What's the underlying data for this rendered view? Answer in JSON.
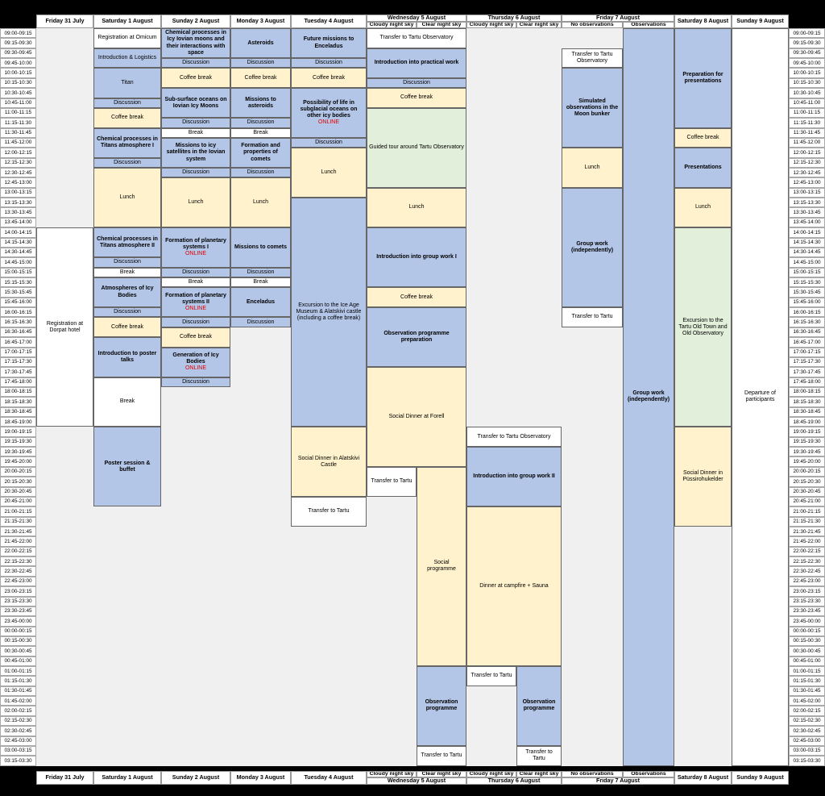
{
  "colors": {
    "session": "#b4c6e7",
    "break": "#fff2cc",
    "tour": "#e2efda",
    "free": "#ffffff",
    "empty": "#f0f0f0",
    "online": "#e00000"
  },
  "days_top": [
    "Friday 31 July",
    "Saturday 1 August",
    "Sunday 2 August",
    "Monday 3 August",
    "Tuesday 4 August",
    "Wednesday 5 August",
    "Thursday 6 August",
    "Friday 7 August",
    "Saturday 8 August",
    "Sunday 9 August"
  ],
  "days_bottom": [
    "Friday 31 July",
    "Saturday 1 August",
    "Sunday 2 August",
    "Monday 3 August",
    "Tuesday 4 August",
    "Wednesday 5 August",
    "Thursday 6 August",
    "Friday 7 August",
    "Saturday 8 August",
    "Sunday 9 August"
  ],
  "sub_top": {
    "wed_cloudy": "Cloudy night sky",
    "wed_clear": "Clear night sky",
    "thu_cloudy": "Cloudy night sky",
    "thu_clear": "Clear night sky",
    "fri_no": "No observations",
    "fri_obs": "Observations"
  },
  "sub_bottom": {
    "wed_cloudy": "Cloudy night sky",
    "wed_clear": "Clear night sky",
    "thu_cloudy": "Cloudy night sky",
    "thu_clear": "Clear night sky",
    "fri_no": "No observations",
    "fri_obs": "Observations"
  },
  "times": [
    "09:00-09:15",
    "09:15-09:30",
    "09:30-09:45",
    "09:45-10:00",
    "10:00-10:15",
    "10:15-10:30",
    "10:30-10:45",
    "10:45-11:00",
    "11:00-11:15",
    "11:15-11:30",
    "11:30-11:45",
    "11:45-12:00",
    "12:00-12:15",
    "12:15-12:30",
    "12:30-12:45",
    "12:45-13:00",
    "13:00-13:15",
    "13:15-13:30",
    "13:30-13:45",
    "13:45-14:00",
    "14:00-14:15",
    "14:15-14:30",
    "14:30-14:45",
    "14:45-15:00",
    "15:00-15:15",
    "15:15-15:30",
    "15:30-15:45",
    "15:45-16:00",
    "16:00-16:15",
    "16:15-16:30",
    "16:30-16:45",
    "16:45-17:00",
    "17:00-17:15",
    "17:15-17:30",
    "17:30-17:45",
    "17:45-18:00",
    "18:00-18:15",
    "18:15-18:30",
    "18:30-18:45",
    "18:45-19:00",
    "19:00-19:15",
    "19:15-19:30",
    "19:30-19:45",
    "19:45-20:00",
    "20:00-20:15",
    "20:15-20:30",
    "20:30-20:45",
    "20:45-21:00",
    "21:00-21:15",
    "21:15-21:30",
    "21:30-21:45",
    "21:45-22:00",
    "22:00-22:15",
    "22:15-22:30",
    "22:30-22:45",
    "22:45-23:00",
    "23:00-23:15",
    "23:15-23:30",
    "23:30-23:45",
    "23:45-00:00",
    "00:00-00:15",
    "00:15-00:30",
    "00:30-00:45",
    "00:45-01:00",
    "01:00-01:15",
    "01:15-01:30",
    "01:30-01:45",
    "01:45-02:00",
    "02:00-02:15",
    "02:15-02:30",
    "02:30-02:45",
    "02:45-03:00",
    "03:00-03:15",
    "03:15-03:30"
  ],
  "events": [
    {
      "col": "fri",
      "start": 0,
      "span": 20,
      "text": "",
      "style": "gry"
    },
    {
      "col": "fri",
      "start": 20,
      "span": 20,
      "text": "Registration at Dorpat hotel",
      "style": "wht"
    },
    {
      "col": "fri",
      "start": 40,
      "span": 34,
      "text": "",
      "style": "gry"
    },
    {
      "col": "sat1",
      "start": 0,
      "span": 2,
      "text": "Registration at Omicum",
      "style": "wht"
    },
    {
      "col": "sat1",
      "start": 2,
      "span": 2,
      "text": "Introduction & Logistics",
      "style": "blue"
    },
    {
      "col": "sat1",
      "start": 4,
      "span": 3,
      "text": "Titan",
      "style": "blue"
    },
    {
      "col": "sat1",
      "start": 7,
      "span": 1,
      "text": "Discussion",
      "style": "blue"
    },
    {
      "col": "sat1",
      "start": 8,
      "span": 2,
      "text": "Coffee break",
      "style": "yel"
    },
    {
      "col": "sat1",
      "start": 10,
      "span": 3,
      "text": "Chemical processes in Titans atmosphere I",
      "style": "blue",
      "bold": true
    },
    {
      "col": "sat1",
      "start": 13,
      "span": 1,
      "text": "Discussion",
      "style": "blue"
    },
    {
      "col": "sat1",
      "start": 14,
      "span": 6,
      "text": "Lunch",
      "style": "yel"
    },
    {
      "col": "sat1",
      "start": 20,
      "span": 3,
      "text": "Chemical processes in Titans atmosphere II",
      "style": "blue",
      "bold": true
    },
    {
      "col": "sat1",
      "start": 23,
      "span": 1,
      "text": "Discussion",
      "style": "blue"
    },
    {
      "col": "sat1",
      "start": 24,
      "span": 1,
      "text": "Break",
      "style": "wht"
    },
    {
      "col": "sat1",
      "start": 25,
      "span": 3,
      "text": "Atmospheres of Icy Bodies",
      "style": "blue",
      "bold": true
    },
    {
      "col": "sat1",
      "start": 28,
      "span": 1,
      "text": "Discussion",
      "style": "blue"
    },
    {
      "col": "sat1",
      "start": 29,
      "span": 2,
      "text": "Coffee break",
      "style": "yel"
    },
    {
      "col": "sat1",
      "start": 31,
      "span": 4,
      "text": "Introduction to poster talks",
      "style": "blue",
      "bold": true
    },
    {
      "col": "sat1",
      "start": 35,
      "span": 5,
      "text": "Break",
      "style": "wht"
    },
    {
      "col": "sat1",
      "start": 40,
      "span": 8,
      "text": "Poster session & buffet",
      "style": "blue",
      "bold": true
    },
    {
      "col": "sat1",
      "start": 48,
      "span": 26,
      "text": "",
      "style": "gry"
    },
    {
      "col": "sun2",
      "start": 0,
      "span": 3,
      "text": "Chemical processes in Icy Iovian moons and their interactions with space",
      "style": "blue",
      "bold": true
    },
    {
      "col": "sun2",
      "start": 3,
      "span": 1,
      "text": "Discussion",
      "style": "blue"
    },
    {
      "col": "sun2",
      "start": 4,
      "span": 2,
      "text": "Coffee break",
      "style": "yel"
    },
    {
      "col": "sun2",
      "start": 6,
      "span": 3,
      "text": "Sub-surface oceans on Iovian Icy Moons",
      "style": "blue",
      "bold": true
    },
    {
      "col": "sun2",
      "start": 9,
      "span": 1,
      "text": "Discussion",
      "style": "blue"
    },
    {
      "col": "sun2",
      "start": 10,
      "span": 1,
      "text": "Break",
      "style": "wht"
    },
    {
      "col": "sun2",
      "start": 11,
      "span": 3,
      "text": "Missions to icy satellites in the Iovian system",
      "style": "blue",
      "bold": true
    },
    {
      "col": "sun2",
      "start": 14,
      "span": 1,
      "text": "Discussion",
      "style": "blue"
    },
    {
      "col": "sun2",
      "start": 15,
      "span": 5,
      "text": "Lunch",
      "style": "yel"
    },
    {
      "col": "sun2",
      "start": 20,
      "span": 4,
      "text": "Formation of planetary systems I",
      "style": "blue",
      "bold": true,
      "online": "ONLINE"
    },
    {
      "col": "sun2",
      "start": 24,
      "span": 1,
      "text": "Discussion",
      "style": "blue"
    },
    {
      "col": "sun2",
      "start": 25,
      "span": 1,
      "text": "Break",
      "style": "wht"
    },
    {
      "col": "sun2",
      "start": 26,
      "span": 3,
      "text": "Formation of planetary systems II",
      "style": "blue",
      "bold": true,
      "online": "ONLINE"
    },
    {
      "col": "sun2",
      "start": 29,
      "span": 1,
      "text": "Discussion",
      "style": "blue"
    },
    {
      "col": "sun2",
      "start": 30,
      "span": 2,
      "text": "Coffee break",
      "style": "yel"
    },
    {
      "col": "sun2",
      "start": 32,
      "span": 3,
      "text": "Generation of Icy Bodies",
      "style": "blue",
      "bold": true,
      "online": "ONLINE"
    },
    {
      "col": "sun2",
      "start": 35,
      "span": 1,
      "text": "Discussion",
      "style": "blue"
    },
    {
      "col": "sun2",
      "start": 36,
      "span": 38,
      "text": "",
      "style": "gry"
    },
    {
      "col": "mon3",
      "start": 0,
      "span": 3,
      "text": "Asteroids",
      "style": "blue",
      "bold": true
    },
    {
      "col": "mon3",
      "start": 3,
      "span": 1,
      "text": "Discussion",
      "style": "blue"
    },
    {
      "col": "mon3",
      "start": 4,
      "span": 2,
      "text": "Coffee break",
      "style": "yel"
    },
    {
      "col": "mon3",
      "start": 6,
      "span": 3,
      "text": "Missions to asteroids",
      "style": "blue",
      "bold": true
    },
    {
      "col": "mon3",
      "start": 9,
      "span": 1,
      "text": "Discussion",
      "style": "blue"
    },
    {
      "col": "mon3",
      "start": 10,
      "span": 1,
      "text": "Break",
      "style": "wht"
    },
    {
      "col": "mon3",
      "start": 11,
      "span": 3,
      "text": "Formation and properties of comets",
      "style": "blue",
      "bold": true
    },
    {
      "col": "mon3",
      "start": 14,
      "span": 1,
      "text": "Discussion",
      "style": "blue"
    },
    {
      "col": "mon3",
      "start": 15,
      "span": 5,
      "text": "Lunch",
      "style": "yel"
    },
    {
      "col": "mon3",
      "start": 20,
      "span": 4,
      "text": "Missions to comets",
      "style": "blue",
      "bold": true
    },
    {
      "col": "mon3",
      "start": 24,
      "span": 1,
      "text": "Discussion",
      "style": "blue"
    },
    {
      "col": "mon3",
      "start": 25,
      "span": 1,
      "text": "Break",
      "style": "wht"
    },
    {
      "col": "mon3",
      "start": 26,
      "span": 3,
      "text": "Enceladus",
      "style": "blue",
      "bold": true
    },
    {
      "col": "mon3",
      "start": 29,
      "span": 1,
      "text": "Discussion",
      "style": "blue"
    },
    {
      "col": "mon3",
      "start": 30,
      "span": 44,
      "text": "",
      "style": "gry"
    },
    {
      "col": "tue4",
      "start": 0,
      "span": 3,
      "text": "Future missions to Enceladus",
      "style": "blue",
      "bold": true
    },
    {
      "col": "tue4",
      "start": 3,
      "span": 1,
      "text": "Discussion",
      "style": "blue"
    },
    {
      "col": "tue4",
      "start": 4,
      "span": 2,
      "text": "Coffee break",
      "style": "yel"
    },
    {
      "col": "tue4",
      "start": 6,
      "span": 5,
      "text": "Possibility of life in subglacial oceans on other icy bodies",
      "style": "blue",
      "bold": true,
      "online": "ONLINE"
    },
    {
      "col": "tue4",
      "start": 11,
      "span": 1,
      "text": "Discussion",
      "style": "blue"
    },
    {
      "col": "tue4",
      "start": 12,
      "span": 5,
      "text": "Lunch",
      "style": "yel"
    },
    {
      "col": "tue4",
      "start": 17,
      "span": 23,
      "text": "Excursion to the Ice Age Museum & Alatskivi castle (including a coffee break)",
      "style": "blue"
    },
    {
      "col": "tue4",
      "start": 40,
      "span": 7,
      "text": "Social Dinner in Alatskivi Castle",
      "style": "yel"
    },
    {
      "col": "tue4",
      "start": 47,
      "span": 3,
      "text": "Transfer to Tartu",
      "style": "wht"
    },
    {
      "col": "tue4",
      "start": 50,
      "span": 24,
      "text": "",
      "style": "gry"
    },
    {
      "col": "wedAll",
      "start": 0,
      "span": 2,
      "text": "Transfer to Tartu Observatory",
      "style": "wht"
    },
    {
      "col": "wedAll",
      "start": 2,
      "span": 3,
      "text": "Introduction into practical work",
      "style": "blue",
      "bold": true
    },
    {
      "col": "wedAll",
      "start": 5,
      "span": 1,
      "text": "Discussion",
      "style": "blue"
    },
    {
      "col": "wedAll",
      "start": 6,
      "span": 2,
      "text": "Coffee break",
      "style": "yel"
    },
    {
      "col": "wedAll",
      "start": 8,
      "span": 8,
      "text": "Guided tour around Tartu Observatory",
      "style": "grn"
    },
    {
      "col": "wedAll",
      "start": 16,
      "span": 4,
      "text": "Lunch",
      "style": "yel"
    },
    {
      "col": "wedAll",
      "start": 20,
      "span": 6,
      "text": "Introduction into group work I",
      "style": "blue",
      "bold": true
    },
    {
      "col": "wedAll",
      "start": 26,
      "span": 2,
      "text": "Coffee break",
      "style": "yel"
    },
    {
      "col": "wedAll",
      "start": 28,
      "span": 6,
      "text": "Observation programme preparation",
      "style": "blue",
      "bold": true
    },
    {
      "col": "wedAll",
      "start": 34,
      "span": 10,
      "text": "Social Dinner at Forell",
      "style": "yel"
    },
    {
      "col": "wedCl",
      "start": 44,
      "span": 3,
      "text": "Transfer to Tartu",
      "style": "wht"
    },
    {
      "col": "wedCl",
      "start": 47,
      "span": 27,
      "text": "",
      "style": "gry"
    },
    {
      "col": "wedCr",
      "start": 44,
      "span": 20,
      "text": "Social programme",
      "style": "yel"
    },
    {
      "col": "wedCr",
      "start": 64,
      "span": 8,
      "text": "Observation programme",
      "style": "blue",
      "bold": true
    },
    {
      "col": "wedCr",
      "start": 72,
      "span": 2,
      "text": "Transfer to Tartu",
      "style": "wht"
    },
    {
      "col": "thuAll",
      "start": 0,
      "span": 40,
      "text": "",
      "style": "gry"
    },
    {
      "col": "thuAll",
      "start": 40,
      "span": 2,
      "text": "Transfer to Tartu Observatory",
      "style": "wht"
    },
    {
      "col": "thuAll",
      "start": 42,
      "span": 6,
      "text": "Introduction into group work II",
      "style": "blue",
      "bold": true
    },
    {
      "col": "thuAll",
      "start": 48,
      "span": 16,
      "text": "Dinner at campfire + Sauna",
      "style": "yel"
    },
    {
      "col": "thuCl",
      "start": 64,
      "span": 2,
      "text": "Transfer to Tartu",
      "style": "wht"
    },
    {
      "col": "thuCl",
      "start": 66,
      "span": 8,
      "text": "",
      "style": "gry"
    },
    {
      "col": "thuCr",
      "start": 64,
      "span": 8,
      "text": "Observation programme",
      "style": "blue",
      "bold": true
    },
    {
      "col": "thuCr",
      "start": 72,
      "span": 2,
      "text": "Transfer to Tartu",
      "style": "wht"
    },
    {
      "col": "friN",
      "start": 0,
      "span": 2,
      "text": "",
      "style": "gry"
    },
    {
      "col": "friN",
      "start": 2,
      "span": 2,
      "text": "Transfer to Tartu Observatory",
      "style": "wht"
    },
    {
      "col": "friN",
      "start": 4,
      "span": 8,
      "text": "Simulated observations in the Moon bunker",
      "style": "blue",
      "bold": true
    },
    {
      "col": "friN",
      "start": 12,
      "span": 4,
      "text": "Lunch",
      "style": "yel"
    },
    {
      "col": "friN",
      "start": 16,
      "span": 12,
      "text": "Group work (independently)",
      "style": "blue",
      "bold": true
    },
    {
      "col": "friN",
      "start": 28,
      "span": 2,
      "text": "Transfer to Tartu",
      "style": "wht"
    },
    {
      "col": "friN",
      "start": 30,
      "span": 44,
      "text": "",
      "style": "gry"
    },
    {
      "col": "friO",
      "start": 0,
      "span": 74,
      "text": "Group work (independently)",
      "style": "blue",
      "bold": true
    },
    {
      "col": "sat8",
      "start": 0,
      "span": 10,
      "text": "Preparation for presentations",
      "style": "blue",
      "bold": true
    },
    {
      "col": "sat8",
      "start": 10,
      "span": 2,
      "text": "Coffee break",
      "style": "yel"
    },
    {
      "col": "sat8",
      "start": 12,
      "span": 4,
      "text": "Presentations",
      "style": "blue",
      "bold": true
    },
    {
      "col": "sat8",
      "start": 16,
      "span": 4,
      "text": "Lunch",
      "style": "yel"
    },
    {
      "col": "sat8",
      "start": 20,
      "span": 20,
      "text": "Excursion to the Tartu Old Town and Old Observatory",
      "style": "grn"
    },
    {
      "col": "sat8",
      "start": 40,
      "span": 10,
      "text": "Social Dinner in Püssirohukelder",
      "style": "yel"
    },
    {
      "col": "sat8",
      "start": 50,
      "span": 24,
      "text": "",
      "style": "gry"
    },
    {
      "col": "sun9",
      "start": 0,
      "span": 74,
      "text": "Departure of participants",
      "style": "wht"
    }
  ]
}
